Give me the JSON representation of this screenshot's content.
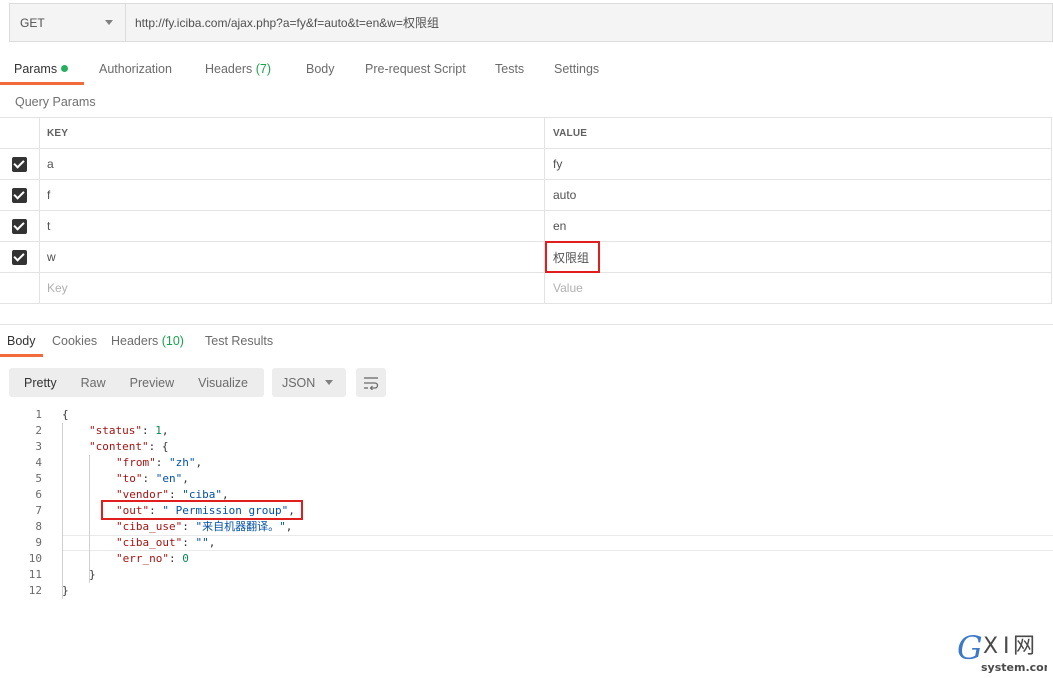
{
  "request": {
    "method": "GET",
    "url": "http://fy.iciba.com/ajax.php?a=fy&f=auto&t=en&w=权限组"
  },
  "request_tabs": [
    {
      "label": "Params",
      "count": "",
      "active": true
    },
    {
      "label": "Authorization",
      "count": ""
    },
    {
      "label": "Headers",
      "count": "(7)"
    },
    {
      "label": "Body",
      "count": ""
    },
    {
      "label": "Pre-request Script",
      "count": ""
    },
    {
      "label": "Tests",
      "count": ""
    },
    {
      "label": "Settings",
      "count": ""
    }
  ],
  "query_params": {
    "title": "Query Params",
    "columns": {
      "key": "KEY",
      "value": "VALUE"
    },
    "rows": [
      {
        "key": "a",
        "value": "fy",
        "checked": true
      },
      {
        "key": "f",
        "value": "auto",
        "checked": true
      },
      {
        "key": "t",
        "value": "en",
        "checked": true
      },
      {
        "key": "w",
        "value": "权限组",
        "checked": true
      }
    ],
    "new_key_placeholder": "Key",
    "new_value_placeholder": "Value"
  },
  "response_tabs": [
    {
      "label": "Body",
      "count": "",
      "active": true
    },
    {
      "label": "Cookies",
      "count": ""
    },
    {
      "label": "Headers",
      "count": "(10)"
    },
    {
      "label": "Test Results",
      "count": ""
    }
  ],
  "view_modes": [
    "Pretty",
    "Raw",
    "Preview",
    "Visualize"
  ],
  "format": "JSON",
  "code_lines": [
    {
      "n": "1",
      "indent": 0,
      "parts": [
        [
          "p",
          "{"
        ]
      ]
    },
    {
      "n": "2",
      "indent": 1,
      "parts": [
        [
          "k",
          "\"status\""
        ],
        [
          "p",
          ": "
        ],
        [
          "n",
          "1"
        ],
        [
          "p",
          ","
        ]
      ]
    },
    {
      "n": "3",
      "indent": 1,
      "parts": [
        [
          "k",
          "\"content\""
        ],
        [
          "p",
          ": {"
        ]
      ]
    },
    {
      "n": "4",
      "indent": 2,
      "parts": [
        [
          "k",
          "\"from\""
        ],
        [
          "p",
          ": "
        ],
        [
          "s",
          "\"zh\""
        ],
        [
          "p",
          ","
        ]
      ]
    },
    {
      "n": "5",
      "indent": 2,
      "parts": [
        [
          "k",
          "\"to\""
        ],
        [
          "p",
          ": "
        ],
        [
          "s",
          "\"en\""
        ],
        [
          "p",
          ","
        ]
      ]
    },
    {
      "n": "6",
      "indent": 2,
      "parts": [
        [
          "k",
          "\"vendor\""
        ],
        [
          "p",
          ": "
        ],
        [
          "s",
          "\"ciba\""
        ],
        [
          "p",
          ","
        ]
      ]
    },
    {
      "n": "7",
      "indent": 2,
      "parts": [
        [
          "k",
          "\"out\""
        ],
        [
          "p",
          ": "
        ],
        [
          "s",
          "\" Permission group\""
        ],
        [
          "p",
          ","
        ]
      ]
    },
    {
      "n": "8",
      "indent": 2,
      "parts": [
        [
          "k",
          "\"ciba_use\""
        ],
        [
          "p",
          ": "
        ],
        [
          "s",
          "\"来自机器翻译。\""
        ],
        [
          "p",
          ","
        ]
      ]
    },
    {
      "n": "9",
      "indent": 2,
      "parts": [
        [
          "k",
          "\"ciba_out\""
        ],
        [
          "p",
          ": "
        ],
        [
          "s",
          "\"\""
        ],
        [
          "p",
          ","
        ]
      ]
    },
    {
      "n": "10",
      "indent": 2,
      "parts": [
        [
          "k",
          "\"err_no\""
        ],
        [
          "p",
          ": "
        ],
        [
          "n",
          "0"
        ]
      ]
    },
    {
      "n": "11",
      "indent": 1,
      "parts": [
        [
          "p",
          "}"
        ]
      ]
    },
    {
      "n": "12",
      "indent": 0,
      "parts": [
        [
          "p",
          "}"
        ]
      ]
    }
  ],
  "colors": {
    "accent": "#f26b3a",
    "count_green": "#1aa14c",
    "highlight_red": "#e01e1e"
  },
  "watermark": {
    "text": "GXI网",
    "sub": "system.com"
  }
}
